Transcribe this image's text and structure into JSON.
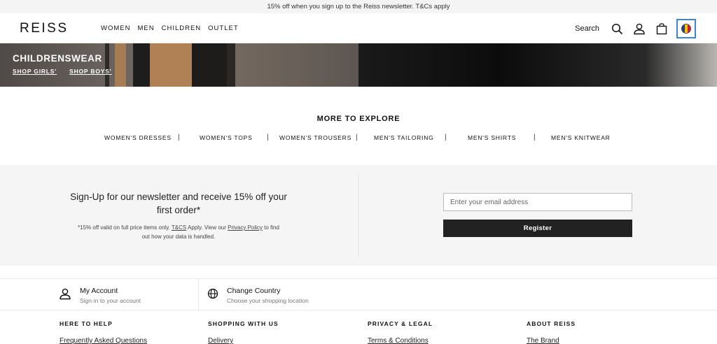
{
  "promo_bar": {
    "text": "15% off when you sign up to the Reiss newsletter. T&Cs apply"
  },
  "header": {
    "logo": "REISS",
    "nav": [
      "WOMEN",
      "MEN",
      "CHILDREN",
      "OUTLET"
    ],
    "search_label": "Search",
    "icons": [
      "search-icon",
      "account-icon",
      "bag-icon",
      "country-flag-icon"
    ]
  },
  "hero": {
    "title": "CHILDRENSWEAR",
    "links": [
      "SHOP GIRLS'",
      "SHOP BOYS'"
    ]
  },
  "explore": {
    "title": "MORE TO EXPLORE",
    "items": [
      "WOMEN'S DRESSES",
      "WOMEN'S TOPS",
      "WOMEN'S TROUSERS",
      "MEN'S TAILORING",
      "MEN'S SHIRTS",
      "MEN'S KNITWEAR"
    ],
    "separator": "|"
  },
  "newsletter": {
    "heading": "Sign-Up for our newsletter and receive 15% off your first order*",
    "note_prefix": "*15% off valid on full price items only. ",
    "note_tcs": "T&CS",
    "note_middle": " Apply. View our ",
    "note_privacy": "Privacy Policy",
    "note_suffix": " to find out how your data is handled.",
    "email_placeholder": "Enter your email address",
    "register_label": "Register"
  },
  "footer_bar": {
    "account_title": "My Account",
    "account_sub": "Sign-in to your account",
    "country_title": "Change Country",
    "country_sub": "Choose your shopping location"
  },
  "footer_links": {
    "columns": [
      {
        "heading": "HERE TO HELP",
        "first_item": "Frequently Asked Questions"
      },
      {
        "heading": "SHOPPING WITH US",
        "first_item": "Delivery"
      },
      {
        "heading": "PRIVACY & LEGAL",
        "first_item": "Terms & Conditions"
      },
      {
        "heading": "ABOUT REISS",
        "first_item": "The Brand"
      }
    ]
  },
  "colors": {
    "flag_blue": "#1f3a93",
    "flag_yellow": "#f5c400",
    "flag_red": "#cc1f2d",
    "focus_outline": "#3b84d6",
    "register_bg": "#222222"
  }
}
